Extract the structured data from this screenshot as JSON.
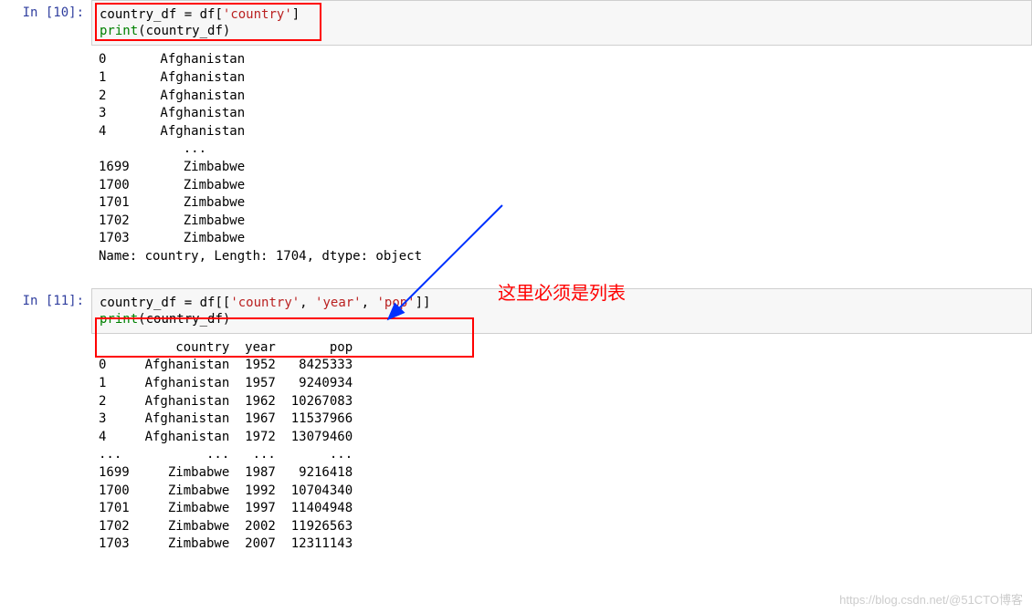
{
  "cell1": {
    "prompt": "In [10]:",
    "code": {
      "var1": "country_df",
      "eq": " = ",
      "var2": "df",
      "lbrack": "[",
      "str1": "'country'",
      "rbrack": "]",
      "line2_func": "print",
      "line2_lp": "(",
      "line2_arg": "country_df",
      "line2_rp": ")"
    },
    "output": "0       Afghanistan\n1       Afghanistan\n2       Afghanistan\n3       Afghanistan\n4       Afghanistan\n           ...     \n1699       Zimbabwe\n1700       Zimbabwe\n1701       Zimbabwe\n1702       Zimbabwe\n1703       Zimbabwe\nName: country, Length: 1704, dtype: object"
  },
  "cell2": {
    "prompt": "In [11]:",
    "code": {
      "var1": "country_df",
      "eq": " = ",
      "var2": "df",
      "lbrack": "[[",
      "str1": "'country'",
      "comma1": ", ",
      "str2": "'year'",
      "comma2": ", ",
      "str3": "'pop'",
      "rbrack": "]]",
      "line2_func": "print",
      "line2_lp": "(",
      "line2_arg": "country_df",
      "line2_rp": ")"
    },
    "output": "          country  year       pop\n0     Afghanistan  1952   8425333\n1     Afghanistan  1957   9240934\n2     Afghanistan  1962  10267083\n3     Afghanistan  1967  11537966\n4     Afghanistan  1972  13079460\n...           ...   ...       ...\n1699     Zimbabwe  1987   9216418\n1700     Zimbabwe  1992  10704340\n1701     Zimbabwe  1997  11404948\n1702     Zimbabwe  2002  11926563\n1703     Zimbabwe  2007  12311143"
  },
  "annotation_text": "这里必须是列表",
  "watermark": "https://blog.csdn.net/@51CTO博客"
}
